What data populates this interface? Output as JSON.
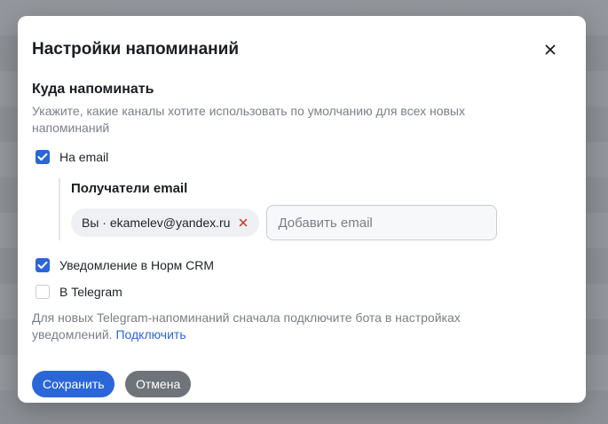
{
  "modal": {
    "title": "Настройки напоминаний",
    "close_icon": "close-icon"
  },
  "where": {
    "title": "Куда напоминать",
    "hint": "Укажите, какие каналы хотите использовать по умолчанию для всех новых напоминаний"
  },
  "channels": {
    "email": {
      "label": "На email",
      "checked": true
    },
    "crm": {
      "label": "Уведомление в Норм CRM",
      "checked": true
    },
    "telegram": {
      "label": "В Telegram",
      "checked": false
    }
  },
  "recipients": {
    "title": "Получатели email",
    "chip_label": "Вы · ekamelev@yandex.ru",
    "add_placeholder": "Добавить email"
  },
  "telegram_hint": {
    "text": "Для новых Telegram-напоминаний сначала подключите бота в настройках уведомлений. ",
    "link": "Подключить"
  },
  "actions": {
    "save": "Сохранить",
    "cancel": "Отмена"
  },
  "colors": {
    "accent": "#2b66d9",
    "secondary_button": "#6f737a",
    "chip_remove": "#c0392b"
  }
}
